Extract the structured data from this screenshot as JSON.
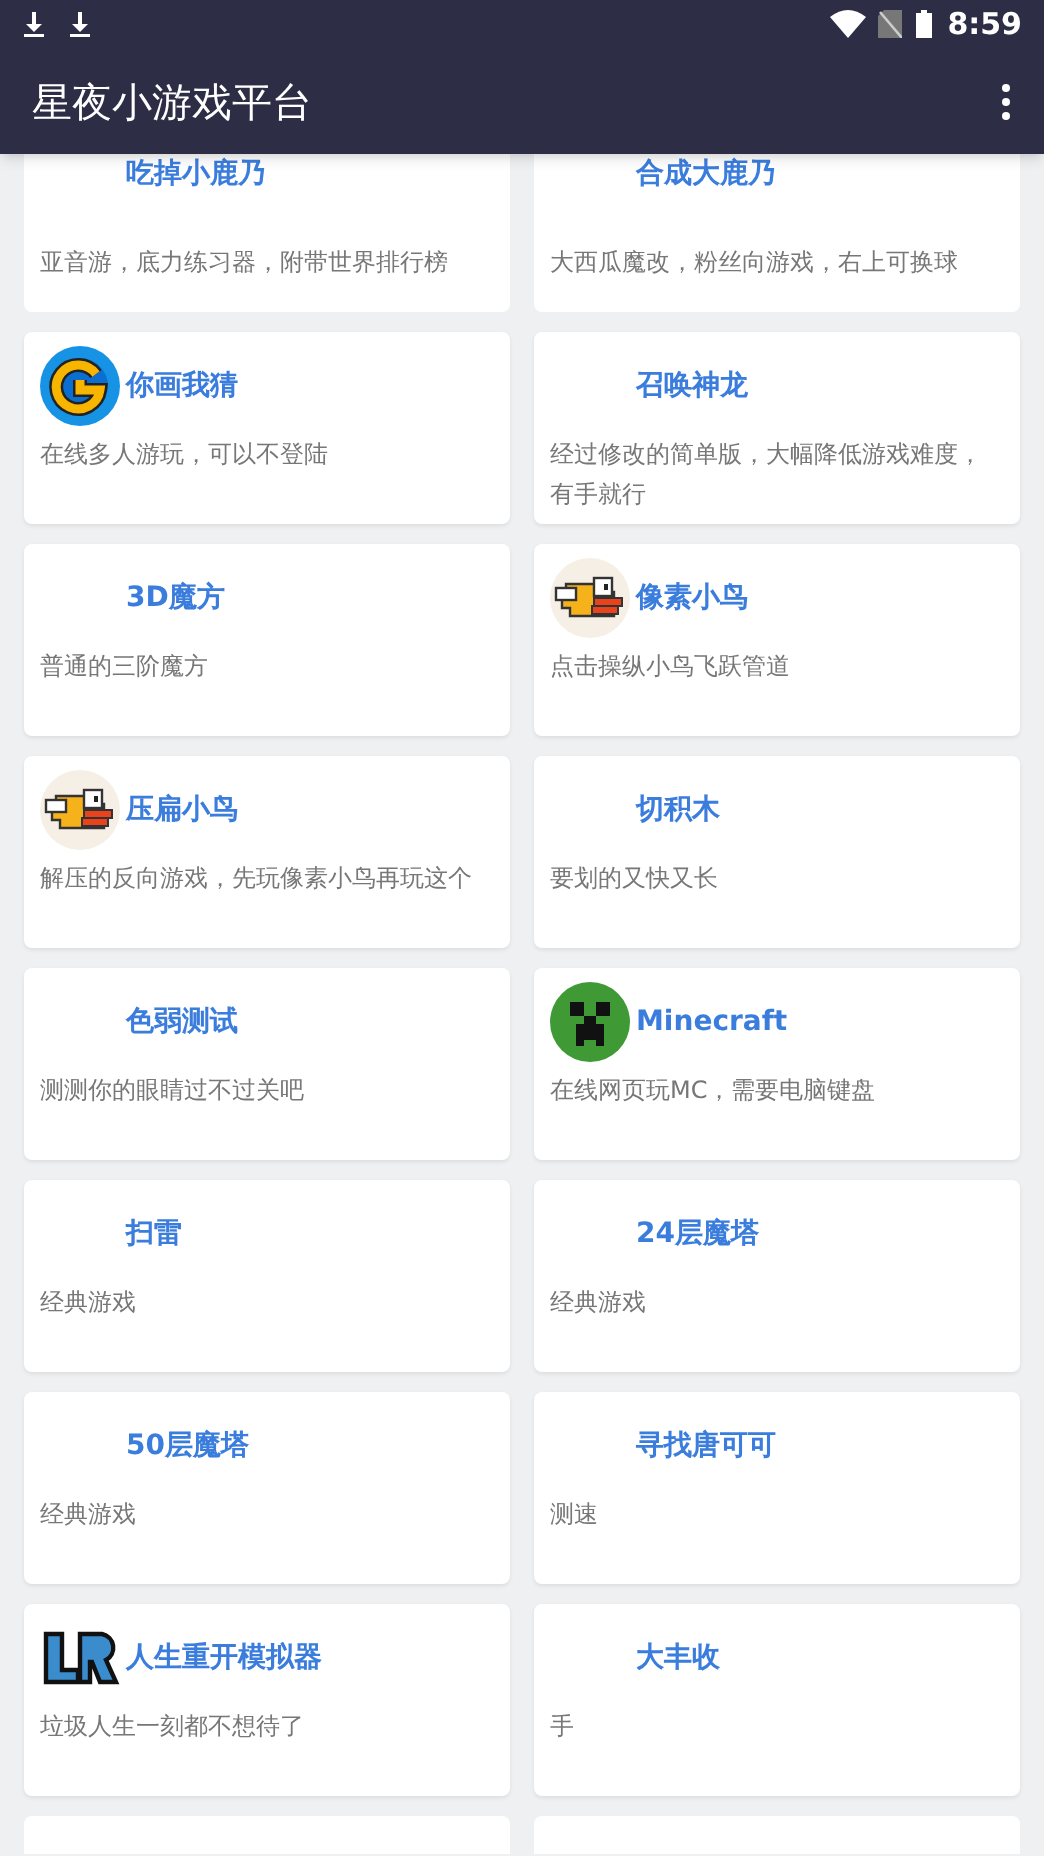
{
  "status_bar": {
    "time": "8:59"
  },
  "app_bar": {
    "title": "星夜小游戏平台"
  },
  "games": [
    {
      "title": "吃掉小鹿乃",
      "description": "亚音游，底力练习器，附带世界排行榜"
    },
    {
      "title": "合成大鹿乃",
      "description": "大西瓜魔改，粉丝向游戏，右上可换球"
    },
    {
      "title": "你画我猜",
      "description": "在线多人游玩，可以不登陆",
      "kind": "g-logo"
    },
    {
      "title": "召唤神龙",
      "description": "经过修改的简单版，大幅降低游戏难度，有手就行"
    },
    {
      "title": "3D魔方",
      "description": "普通的三阶魔方"
    },
    {
      "title": "像素小鸟",
      "description": "点击操纵小鸟飞跃管道",
      "kind": "bird"
    },
    {
      "title": "压扁小鸟",
      "description": "解压的反向游戏，先玩像素小鸟再玩这个",
      "kind": "bird"
    },
    {
      "title": "切积木",
      "description": "要划的又快又长"
    },
    {
      "title": "色弱测试",
      "description": "测测你的眼睛过不过关吧"
    },
    {
      "title": "Minecraft",
      "description": "在线网页玩MC，需要电脑键盘",
      "kind": "creeper"
    },
    {
      "title": "扫雷",
      "description": "经典游戏"
    },
    {
      "title": "24层魔塔",
      "description": "经典游戏"
    },
    {
      "title": "50层魔塔",
      "description": "经典游戏"
    },
    {
      "title": "寻找唐可可",
      "description": "测速"
    },
    {
      "title": "人生重开模拟器",
      "description": "垃圾人生一刻都不想待了",
      "kind": "lr"
    },
    {
      "title": "大丰收",
      "description": "手"
    }
  ]
}
